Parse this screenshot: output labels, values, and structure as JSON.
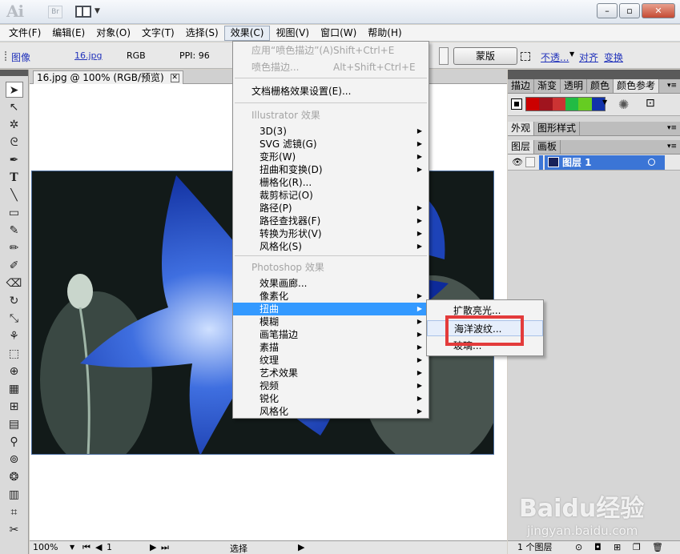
{
  "app": {
    "logo": "Ai",
    "bridge_label": "Br"
  },
  "menubar": [
    {
      "label": "文件(F)"
    },
    {
      "label": "编辑(E)"
    },
    {
      "label": "对象(O)"
    },
    {
      "label": "文字(T)"
    },
    {
      "label": "选择(S)"
    },
    {
      "label": "效果(C)",
      "active": true
    },
    {
      "label": "视图(V)"
    },
    {
      "label": "窗口(W)"
    },
    {
      "label": "帮助(H)"
    }
  ],
  "control_bar": {
    "object_type": "图像",
    "file_name": "16.jpg",
    "color_mode": "RGB",
    "ppi": "PPI: 96",
    "mask_button": "蒙版",
    "opacity_link": "不透...",
    "align_link": "对齐",
    "transform_link": "变换"
  },
  "document": {
    "tab_title": "16.jpg @ 100% (RGB/预览)",
    "zoom": "100%",
    "page": "1",
    "status": "选择"
  },
  "effect_menu": {
    "items": [
      {
        "label": "应用“喷色描边”(A)",
        "shortcut": "Shift+Ctrl+E",
        "disabled": true
      },
      {
        "label": "喷色描边...",
        "shortcut": "Alt+Shift+Ctrl+E",
        "disabled": true
      },
      {
        "label": "文档栅格效果设置(E)..."
      },
      {
        "label": "Illustrator 效果",
        "disabled": true
      },
      {
        "label": "3D(3)",
        "submenu": true
      },
      {
        "label": "SVG 滤镜(G)",
        "submenu": true
      },
      {
        "label": "变形(W)",
        "submenu": true
      },
      {
        "label": "扭曲和变换(D)",
        "submenu": true
      },
      {
        "label": "栅格化(R)..."
      },
      {
        "label": "裁剪标记(O)"
      },
      {
        "label": "路径(P)",
        "submenu": true
      },
      {
        "label": "路径查找器(F)",
        "submenu": true
      },
      {
        "label": "转换为形状(V)",
        "submenu": true
      },
      {
        "label": "风格化(S)",
        "submenu": true
      },
      {
        "label": "Photoshop 效果",
        "disabled": true
      },
      {
        "label": "效果画廊..."
      },
      {
        "label": "像素化",
        "submenu": true
      },
      {
        "label": "扭曲",
        "submenu": true,
        "highlighted": true
      },
      {
        "label": "模糊",
        "submenu": true
      },
      {
        "label": "画笔描边",
        "submenu": true
      },
      {
        "label": "素描",
        "submenu": true
      },
      {
        "label": "纹理",
        "submenu": true
      },
      {
        "label": "艺术效果",
        "submenu": true
      },
      {
        "label": "视频",
        "submenu": true
      },
      {
        "label": "锐化",
        "submenu": true
      },
      {
        "label": "风格化",
        "submenu": true
      }
    ]
  },
  "distort_submenu": {
    "items": [
      {
        "label": "扩散亮光..."
      },
      {
        "label": "海洋波纹...",
        "hovered": true
      },
      {
        "label": "玻璃..."
      }
    ]
  },
  "right_panel": {
    "top_tabs": [
      "描边",
      "渐变",
      "透明",
      "颜色",
      "颜色参考"
    ],
    "mid_tabs": [
      "外观",
      "图形样式"
    ],
    "layer_tabs": [
      "图层",
      "画板"
    ],
    "layer_name": "图层 1",
    "layer_count": "1 个图层",
    "swatches": [
      "#cc0000",
      "#a0141e",
      "#cc3333",
      "#22bb44",
      "#66cc22",
      "#1133aa"
    ]
  },
  "watermark": {
    "brand": "Baidu经验",
    "url": "jingyan.baidu.com"
  }
}
